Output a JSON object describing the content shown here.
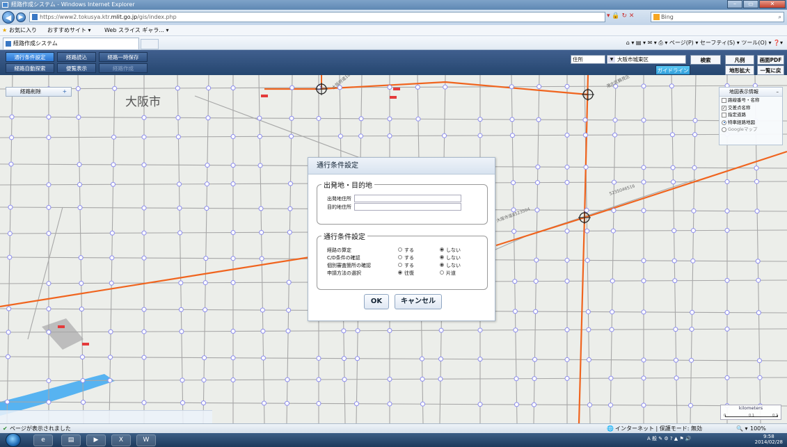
{
  "window": {
    "title": "経路作成システム - Windows Internet Explorer",
    "controls": [
      "–",
      "▭",
      "✕"
    ]
  },
  "browser": {
    "back_icon": "back-arrow-icon",
    "forward_icon": "forward-arrow-icon",
    "url_prefix": "https://www2.tokusya.ktr.",
    "url_domain": "mlit.go.jp",
    "url_suffix": "/gis/index.php",
    "search_placeholder": "Bing",
    "favorites_label": "お気に入り",
    "favorites_items": [
      "おすすめサイト ▾",
      "Web スライス ギャラ... ▾"
    ],
    "tab_title": "経路作成システム",
    "command_bar": "ページ(P) ▾  セーフティ(S) ▾  ツール(O) ▾"
  },
  "app_toolbar": {
    "btn_route_conditions": "通行条件設定",
    "btn_route_load": "経路読込",
    "btn_route_save_temp": "経路一時保存",
    "btn_auto_search": "経路自動探索",
    "btn_easy_display": "便覧表示",
    "btn_disabled": "経路作成",
    "address_type": "住所",
    "address_value": "大阪市城東区",
    "btn_search": "検索",
    "btn_legend": "凡例",
    "btn_screen_pdf": "画面PDF",
    "btn_guideline": "ガイドライン",
    "btn_enlarge": "地形拡大",
    "btn_back_to_list": "一覧に戻る"
  },
  "map": {
    "city_label": "大阪市",
    "route_delete_label": "経路削除",
    "layer_panel": {
      "title": "地図表示情報",
      "items": [
        {
          "label": "路線番号・名称",
          "type": "checkbox",
          "checked": false
        },
        {
          "label": "交差点名称",
          "type": "checkbox",
          "checked": true
        },
        {
          "label": "指定道路",
          "type": "checkbox",
          "checked": false
        },
        {
          "label": "特車経路地図",
          "type": "radio",
          "checked": true
        },
        {
          "label": "Googleマップ",
          "type": "radio",
          "checked": false
        }
      ]
    },
    "scale": {
      "unit": "kilometers",
      "ticks": [
        "0",
        "0.1",
        "0.2"
      ]
    },
    "road_labels": [
      "大阪府道18",
      "港北区鶴見区",
      "5235046516",
      "大阪市道8523504"
    ]
  },
  "dialog": {
    "title": "通行条件設定",
    "section1_legend": "出発地・目的地",
    "origin_label": "出発地住所",
    "destination_label": "目的地住所",
    "origin_value": "",
    "destination_value": "",
    "section2_legend": "通行条件設定",
    "conditions": [
      {
        "label": "経路の算定",
        "opt1": "する",
        "opt2": "しない",
        "selected": 2
      },
      {
        "label": "C/D条件の確認",
        "opt1": "する",
        "opt2": "しない",
        "selected": 2
      },
      {
        "label": "個別審査箇所の確認",
        "opt1": "する",
        "opt2": "しない",
        "selected": 2
      },
      {
        "label": "申請方法の選択",
        "opt1": "往復",
        "opt2": "片道",
        "selected": 1
      }
    ],
    "ok_label": "OK",
    "cancel_label": "キャンセル"
  },
  "status_bar": {
    "left_text": "ページが表示されました",
    "zone_text": "インターネット | 保護モード: 無効",
    "zoom_text": "100%"
  },
  "taskbar": {
    "clock_time": "9:58",
    "clock_date": "2014/02/28"
  },
  "colors": {
    "route_orange": "#f0641e",
    "road_gray": "#a7a7a7",
    "node_purple": "#8c8cf0",
    "river_blue": "#57b3f1",
    "toolbar_blue": "#2f5182",
    "selected_blue": "#2a74d1"
  }
}
